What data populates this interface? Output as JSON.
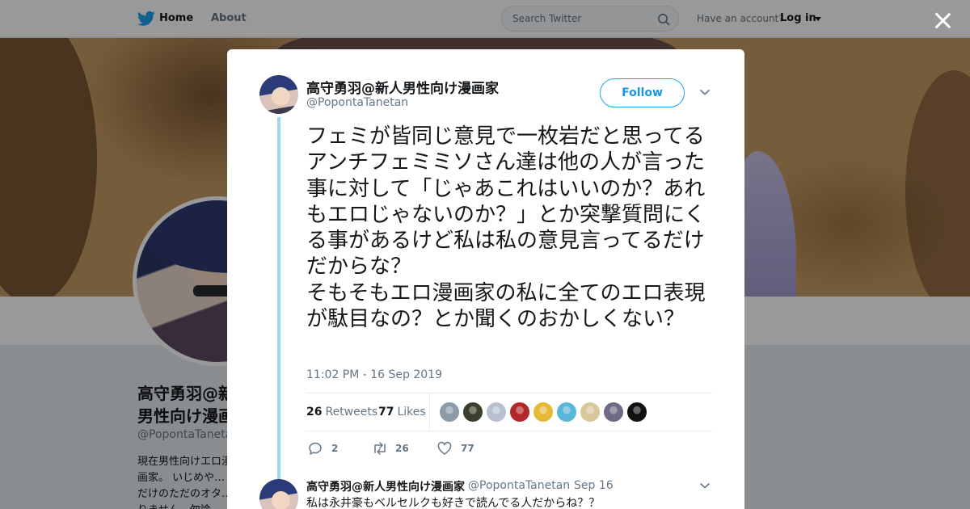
{
  "nav": {
    "home_label": "Home",
    "about_label": "About",
    "search_placeholder": "Search Twitter",
    "have_account": "Have an account?",
    "login_label": "Log in"
  },
  "profile": {
    "name": "高守勇羽@新人男性向け漫画家",
    "handle": "@PopontaTanetan",
    "bio": "現在男性向けエロ漫画家。 いじめや…だけのただのオタ…りません。勿論…"
  },
  "tweet": {
    "author_name": "高守勇羽@新人男性向け漫画家",
    "author_handle": "@PopontaTanetan",
    "follow_label": "Follow",
    "text": "フェミが皆同じ意見で一枚岩だと思ってるアンチフェミミソさん達は他の人が言った事に対して「じゃあこれはいいのか？あれもエロじゃないのか？」とか突撃質問にくる事があるけど私は私の意見言ってるだけだからな？\nそもそもエロ漫画家の私に全てのエロ表現が駄目なの？とか聞くのおかしくない？",
    "timestamp": "11:02 PM - 16 Sep 2019",
    "retweets_count": "26",
    "retweets_label": "Retweets",
    "likes_count": "77",
    "likes_label": "Likes",
    "actions": {
      "reply_count": "2",
      "retweet_count": "26",
      "like_count": "77"
    },
    "liker_avatar_colors": [
      "#8a9aa8",
      "#3a3f2e",
      "#b7bfd0",
      "#b3262a",
      "#e6b93a",
      "#58b6d9",
      "#d8c79a",
      "#6f6a86",
      "#111111"
    ]
  },
  "reply": {
    "author_name": "高守勇羽@新人男性向け漫画家",
    "author_handle": "@PopontaTanetan",
    "separator": "·",
    "date": "Sep 16",
    "text": "私は永井豪もベルセルクも好きで読んでる人だからね？？"
  },
  "colors": {
    "twitter_blue": "#1da1f2",
    "thread_line": "#9fd6f4",
    "overlay": "rgba(0,0,0,0.4)"
  },
  "icons": [
    "twitter-bird-icon",
    "search-icon",
    "caret-down-icon",
    "close-icon",
    "chevron-down-icon",
    "reply-icon",
    "retweet-icon",
    "heart-icon"
  ]
}
